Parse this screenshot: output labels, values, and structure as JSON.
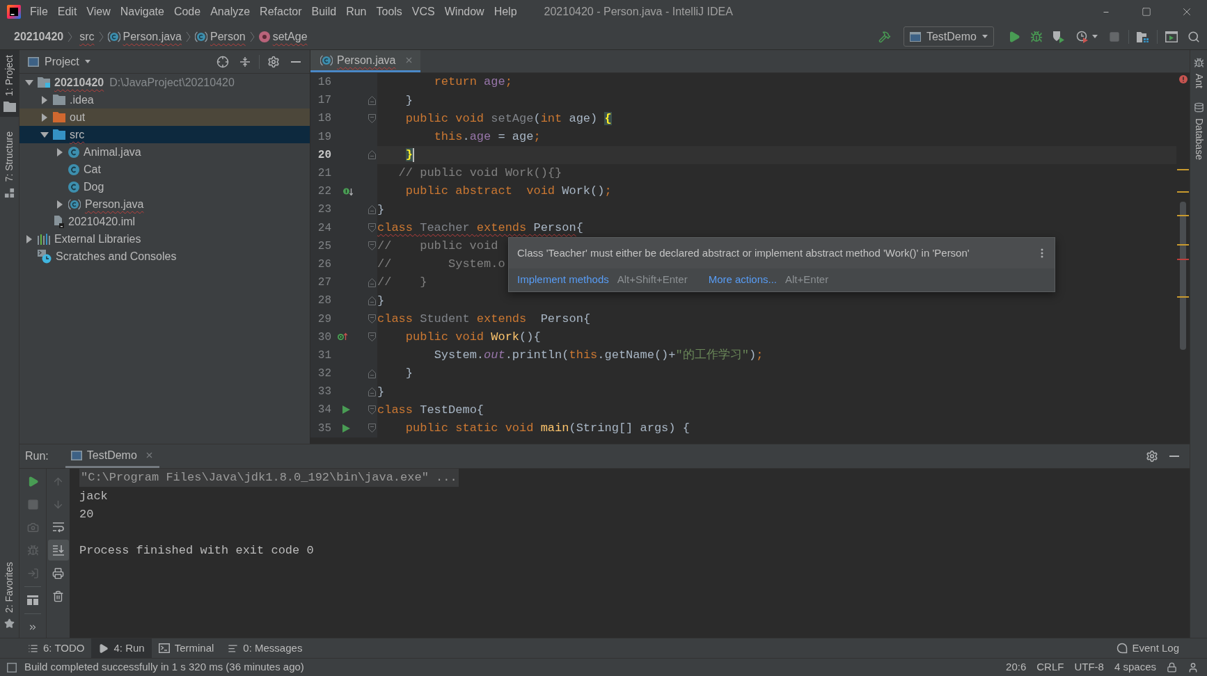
{
  "title_bar": {
    "menus": [
      "File",
      "Edit",
      "View",
      "Navigate",
      "Code",
      "Analyze",
      "Refactor",
      "Build",
      "Run",
      "Tools",
      "VCS",
      "Window",
      "Help"
    ],
    "title": "20210420 - Person.java - IntelliJ IDEA"
  },
  "nav_bar": {
    "breadcrumbs": [
      {
        "label": "20210420",
        "kind": "project",
        "error": false
      },
      {
        "label": "src",
        "kind": "folder",
        "error": true
      },
      {
        "label": "Person.java",
        "kind": "abstract-class",
        "error": true
      },
      {
        "label": "Person",
        "kind": "abstract-class",
        "error": true
      },
      {
        "label": "setAge",
        "kind": "method",
        "error": true
      }
    ],
    "toolbar": [
      {
        "kind": "build",
        "disabled": false
      },
      {
        "kind": "run-config",
        "label": "TestDemo",
        "disabled": false
      },
      {
        "kind": "run",
        "disabled": false
      },
      {
        "kind": "debug",
        "disabled": false
      },
      {
        "kind": "coverage",
        "disabled": false
      },
      {
        "kind": "profile",
        "disabled": false
      },
      {
        "kind": "stop",
        "disabled": true
      },
      {
        "kind": "project-structure",
        "disabled": false
      },
      {
        "kind": "terminal",
        "disabled": false
      },
      {
        "kind": "search",
        "disabled": false
      }
    ]
  },
  "left_strip": {
    "top": [
      {
        "label": "1: Project",
        "kind": "project",
        "selected": true
      },
      {
        "label": "7: Structure",
        "kind": "structure",
        "selected": false
      }
    ],
    "bottom": [
      {
        "label": "2: Favorites",
        "kind": "favorites",
        "selected": false
      }
    ]
  },
  "project_panel": {
    "title": "Project",
    "tree": [
      {
        "label": "20210420",
        "detail": "D:\\JavaProject\\20210420",
        "kind": "module",
        "expanded": true,
        "selected": false,
        "error": true,
        "children": [
          {
            "label": ".idea",
            "kind": "folder",
            "expanded": false,
            "selected": false,
            "error": false
          },
          {
            "label": "out",
            "kind": "excluded-folder",
            "expanded": false,
            "selected": false,
            "error": false
          },
          {
            "label": "src",
            "kind": "source-folder",
            "expanded": true,
            "selected": true,
            "error": true,
            "children": [
              {
                "label": "Animal.java",
                "kind": "class",
                "expanded": false,
                "selected": false,
                "error": false
              },
              {
                "label": "Cat",
                "kind": "class",
                "selected": false,
                "error": false
              },
              {
                "label": "Dog",
                "kind": "class",
                "selected": false,
                "error": false
              },
              {
                "label": "Person.java",
                "kind": "abstract-class",
                "expanded": false,
                "selected": false,
                "error": true
              }
            ]
          },
          {
            "label": "20210420.iml",
            "kind": "module-file",
            "selected": false,
            "error": false
          }
        ]
      },
      {
        "label": "External Libraries",
        "kind": "libraries",
        "expanded": false,
        "selected": false,
        "error": false
      },
      {
        "label": "Scratches and Consoles",
        "kind": "scratches",
        "selected": false,
        "error": false
      }
    ]
  },
  "editor": {
    "tabs": [
      {
        "label": "Person.java",
        "selected": true,
        "error": true
      }
    ],
    "lines": [
      {
        "number": "16",
        "current": false,
        "tokens": [
          {
            "kind": "keyword",
            "text": "        return "
          },
          {
            "kind": "field",
            "text": "age"
          },
          {
            "kind": "keyword",
            "text": ";"
          }
        ]
      },
      {
        "number": "17",
        "current": false,
        "fold": {
          "kind": "end"
        },
        "tokens": [
          {
            "kind": "plain",
            "text": "    }"
          }
        ]
      },
      {
        "number": "18",
        "current": false,
        "fold": {
          "kind": "start"
        },
        "tokens": [
          {
            "kind": "keyword",
            "text": "    public void "
          },
          {
            "kind": "unused",
            "text": "setAge"
          },
          {
            "kind": "plain",
            "text": "("
          },
          {
            "kind": "keyword",
            "text": "int"
          },
          {
            "kind": "plain",
            "text": " age) "
          },
          {
            "kind": "brace",
            "text": "{"
          }
        ]
      },
      {
        "number": "19",
        "current": false,
        "tokens": [
          {
            "kind": "keyword",
            "text": "        this"
          },
          {
            "kind": "plain",
            "text": "."
          },
          {
            "kind": "field",
            "text": "age"
          },
          {
            "kind": "plain",
            "text": " = age"
          },
          {
            "kind": "keyword",
            "text": ";"
          }
        ]
      },
      {
        "number": "20",
        "current": true,
        "fold": {
          "kind": "end"
        },
        "tokens": [
          {
            "kind": "brace",
            "text": "    }"
          }
        ]
      },
      {
        "number": "21",
        "current": false,
        "tokens": [
          {
            "kind": "comment",
            "text": "   // public void Work(){}"
          }
        ]
      },
      {
        "number": "22",
        "current": false,
        "gutter": {
          "kind": "implemented"
        },
        "tokens": [
          {
            "kind": "keyword",
            "text": "    public abstract  void"
          },
          {
            "kind": "plain",
            "text": " Work()"
          },
          {
            "kind": "keyword",
            "text": ";"
          }
        ]
      },
      {
        "number": "23",
        "current": false,
        "fold": {
          "kind": "end"
        },
        "tokens": [
          {
            "kind": "plain",
            "text": "}"
          }
        ]
      },
      {
        "number": "24",
        "current": false,
        "fold": {
          "kind": "start"
        },
        "tokens": [
          {
            "kind": "error",
            "children": [
              {
                "kind": "keyword",
                "text": "class "
              },
              {
                "kind": "unused",
                "text": "Teacher "
              },
              {
                "kind": "keyword",
                "text": "extends"
              },
              {
                "kind": "plain",
                "text": " Person"
              }
            ]
          },
          {
            "kind": "plain",
            "text": "{"
          }
        ]
      },
      {
        "number": "25",
        "current": false,
        "fold": {
          "kind": "start"
        },
        "tokens": [
          {
            "kind": "comment",
            "text": "//    public void"
          }
        ]
      },
      {
        "number": "26",
        "current": false,
        "tokens": [
          {
            "kind": "comment",
            "text": "//        System.o"
          }
        ]
      },
      {
        "number": "27",
        "current": false,
        "fold": {
          "kind": "end"
        },
        "tokens": [
          {
            "kind": "comment",
            "text": "//    }"
          }
        ]
      },
      {
        "number": "28",
        "current": false,
        "fold": {
          "kind": "end"
        },
        "tokens": [
          {
            "kind": "plain",
            "text": "}"
          }
        ]
      },
      {
        "number": "29",
        "current": false,
        "fold": {
          "kind": "start"
        },
        "tokens": [
          {
            "kind": "keyword",
            "text": "class "
          },
          {
            "kind": "unused",
            "text": "Student "
          },
          {
            "kind": "keyword",
            "text": "extends"
          },
          {
            "kind": "plain",
            "text": "  Person{"
          }
        ]
      },
      {
        "number": "30",
        "current": false,
        "fold": {
          "kind": "start"
        },
        "gutter": {
          "kind": "overrides"
        },
        "tokens": [
          {
            "kind": "keyword",
            "text": "    public void "
          },
          {
            "kind": "method",
            "text": "Work"
          },
          {
            "kind": "plain",
            "text": "(){"
          }
        ]
      },
      {
        "number": "31",
        "current": false,
        "tokens": [
          {
            "kind": "plain",
            "text": "        System."
          },
          {
            "kind": "static-field",
            "text": "out"
          },
          {
            "kind": "plain",
            "text": ".println("
          },
          {
            "kind": "keyword",
            "text": "this"
          },
          {
            "kind": "plain",
            "text": ".getName()+"
          },
          {
            "kind": "string",
            "text": "\"的工作学习\""
          },
          {
            "kind": "plain",
            "text": ")"
          },
          {
            "kind": "keyword",
            "text": ";"
          }
        ]
      },
      {
        "number": "32",
        "current": false,
        "fold": {
          "kind": "end"
        },
        "tokens": [
          {
            "kind": "plain",
            "text": "    }"
          }
        ]
      },
      {
        "number": "33",
        "current": false,
        "fold": {
          "kind": "end"
        },
        "tokens": [
          {
            "kind": "plain",
            "text": "}"
          }
        ]
      },
      {
        "number": "34",
        "current": false,
        "fold": {
          "kind": "start"
        },
        "gutter": {
          "kind": "run"
        },
        "tokens": [
          {
            "kind": "keyword",
            "text": "class"
          },
          {
            "kind": "plain",
            "text": " TestDemo{"
          }
        ]
      },
      {
        "number": "35",
        "current": false,
        "fold": {
          "kind": "start"
        },
        "gutter": {
          "kind": "run"
        },
        "tokens": [
          {
            "kind": "keyword",
            "text": "    public static void "
          },
          {
            "kind": "method",
            "text": "main"
          },
          {
            "kind": "plain",
            "text": "(String[] args) {"
          }
        ]
      }
    ],
    "tooltip": {
      "message": "Class 'Teacher' must either be declared abstract or implement abstract method 'Work()' in 'Person'",
      "actions": [
        {
          "label": "Implement methods",
          "shortcut": "Alt+Shift+Enter"
        },
        {
          "label": "More actions...",
          "shortcut": "Alt+Enter"
        }
      ]
    }
  },
  "right_strip": [
    {
      "label": "Ant",
      "kind": "ant",
      "selected": false
    },
    {
      "label": "Database",
      "kind": "database",
      "selected": false
    }
  ],
  "run_panel": {
    "title": "Run:",
    "tabs": [
      {
        "label": "TestDemo",
        "selected": true
      }
    ],
    "controls": [
      {
        "kind": "rerun",
        "disabled": false
      },
      {
        "kind": "stop",
        "disabled": true
      },
      {
        "kind": "camera",
        "disabled": true
      },
      {
        "kind": "bug",
        "disabled": true
      },
      {
        "kind": "exit",
        "disabled": true
      },
      {
        "kind": "layout",
        "disabled": false
      },
      {
        "kind": "more",
        "disabled": false
      }
    ],
    "output_actions": [
      {
        "kind": "up",
        "disabled": true,
        "toggled": false
      },
      {
        "kind": "down",
        "disabled": true,
        "toggled": false
      },
      {
        "kind": "soft-wrap",
        "disabled": false,
        "toggled": false
      },
      {
        "kind": "scroll-end",
        "disabled": false,
        "toggled": true
      },
      {
        "kind": "print",
        "disabled": false,
        "toggled": false
      },
      {
        "kind": "trash",
        "disabled": false,
        "toggled": false
      }
    ],
    "console": [
      {
        "kind": "command",
        "text": "\"C:\\Program Files\\Java\\jdk1.8.0_192\\bin\\java.exe\" ..."
      },
      {
        "kind": "output",
        "text": "jack"
      },
      {
        "kind": "output",
        "text": "20"
      },
      {
        "kind": "system",
        "text": "Process finished with exit code 0"
      }
    ]
  },
  "tool_window_bar": {
    "tabs": [
      {
        "label": "6: TODO",
        "kind": "todo",
        "selected": false
      },
      {
        "label": "4: Run",
        "kind": "run",
        "selected": true
      },
      {
        "label": "Terminal",
        "kind": "terminal",
        "selected": false
      },
      {
        "label": "0: Messages",
        "kind": "messages",
        "selected": false
      }
    ],
    "event_log": "Event Log"
  },
  "status_bar": {
    "message": "Build completed successfully in 1 s 320 ms (36 minutes ago)",
    "position": "20:6",
    "line_separator": "CRLF",
    "encoding": "UTF-8",
    "indent": "4 spaces"
  }
}
